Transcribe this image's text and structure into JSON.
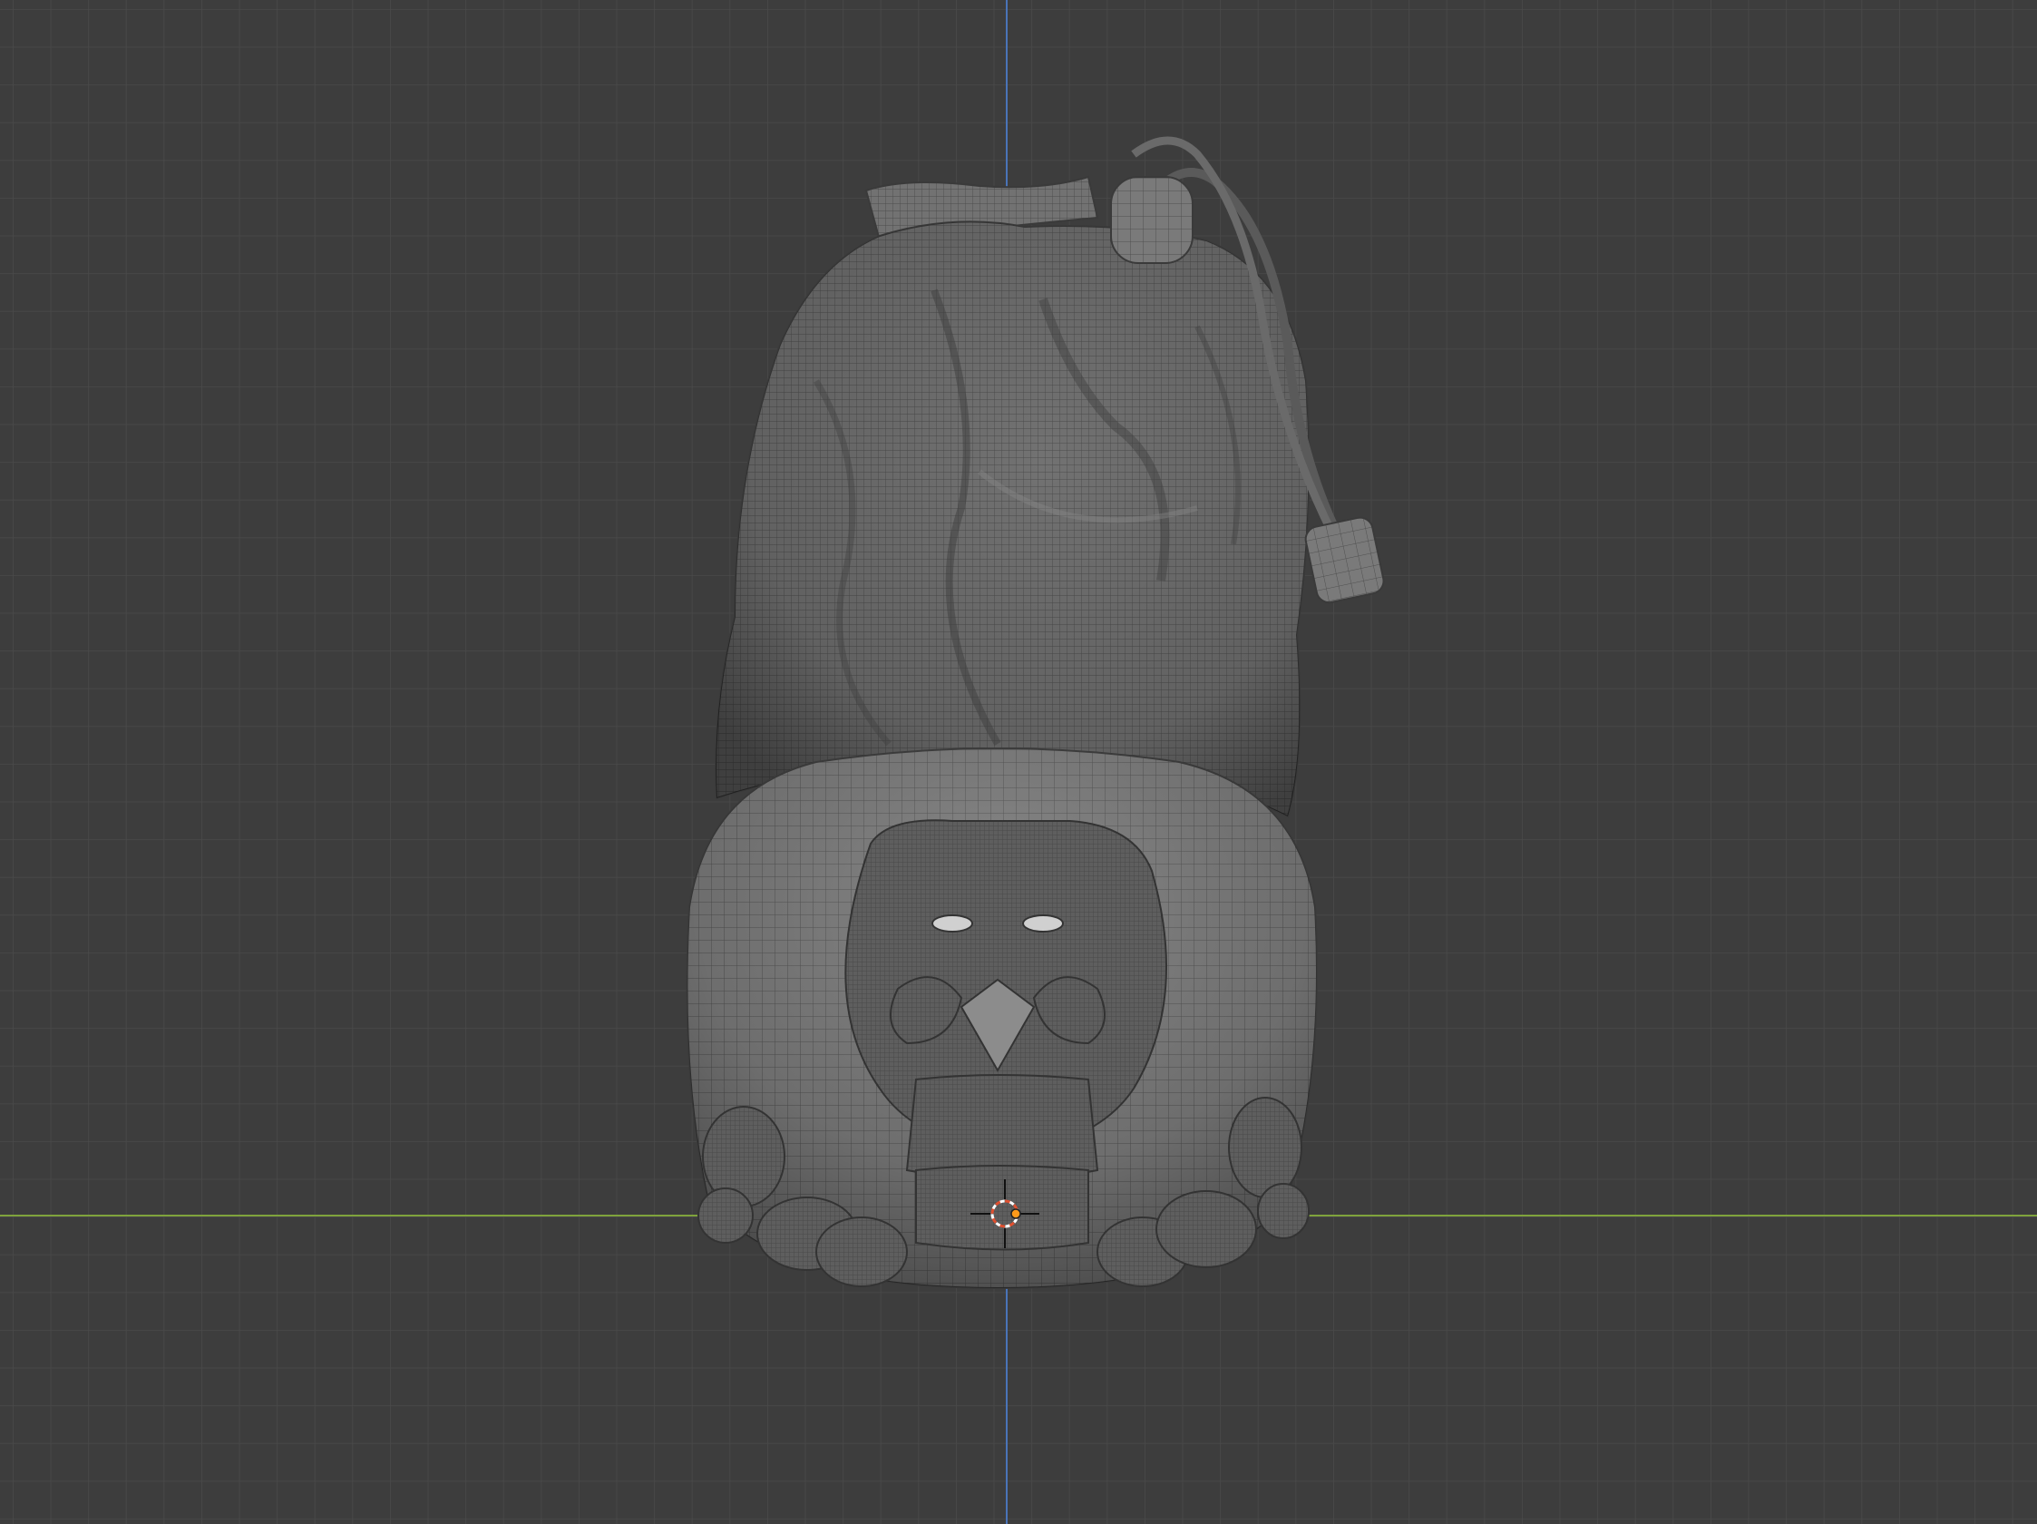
{
  "viewport": {
    "view": "front-orthographic",
    "background_color": "#3d3d3d",
    "grid_color": "#4a4a4a",
    "x_axis_color": "#7fa33c",
    "y_axis_color": "#4a74b8",
    "mesh_color": "#6a6a6a",
    "wireframe_color": "#3a3a3a",
    "cursor_color": "#e05030"
  },
  "object": {
    "type": "mesh",
    "description_icon": "sculpted-drawstring-bag-mesh",
    "wireframe_overlay": true
  },
  "cursor_3d": {
    "icon": "3d-cursor-icon"
  },
  "origin": {
    "icon": "object-origin-icon"
  }
}
